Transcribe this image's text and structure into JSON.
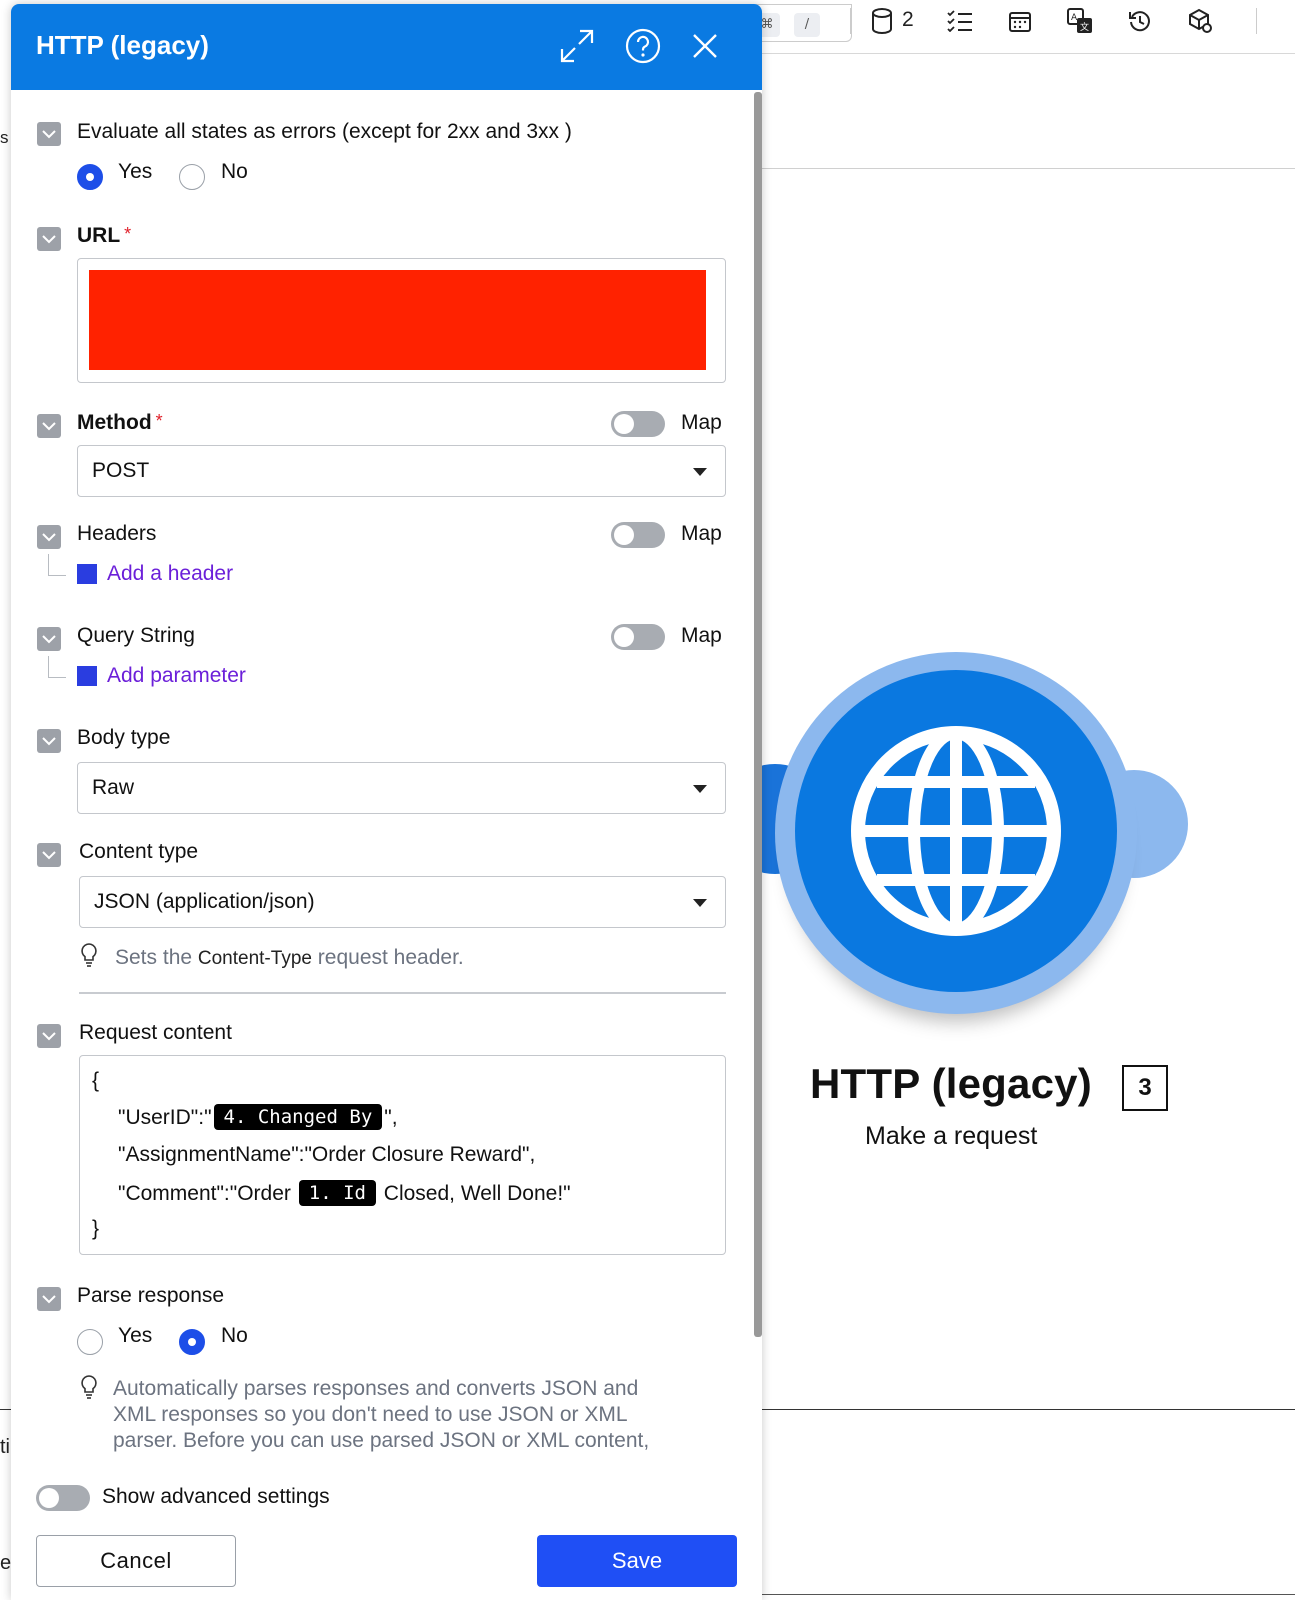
{
  "toolbar": {
    "kbd_cmd": "⌘",
    "kbd_slash": "/",
    "datastore_count": "2",
    "icons": [
      "database-icon",
      "checklist-icon",
      "calendar-icon",
      "translate-icon",
      "history-icon",
      "package-settings-icon"
    ]
  },
  "background": {
    "edge_s": "s",
    "edge_ti": "ti",
    "edge_e": "e"
  },
  "module": {
    "title": "HTTP (legacy)",
    "badge": "3",
    "subtitle": "Make a request",
    "icon": "globe-icon"
  },
  "panel": {
    "title": "HTTP (legacy)",
    "evaluate": {
      "label": "Evaluate all states as errors (except for 2xx and 3xx )",
      "yes": "Yes",
      "no": "No",
      "selected": "Yes"
    },
    "url": {
      "label": "URL",
      "required": "*"
    },
    "method": {
      "label": "Method",
      "required": "*",
      "map": "Map",
      "value": "POST"
    },
    "headers": {
      "label": "Headers",
      "map": "Map",
      "add": "Add a header"
    },
    "query": {
      "label": "Query String",
      "map": "Map",
      "add": "Add parameter"
    },
    "body_type": {
      "label": "Body type",
      "value": "Raw"
    },
    "content_type": {
      "label": "Content type",
      "value": "JSON (application/json)",
      "hint_pre": "Sets the ",
      "hint_code": "Content-Type",
      "hint_post": " request header."
    },
    "request_content": {
      "label": "Request content",
      "open_brace": "{",
      "line1_pre": "\"UserID\":\"",
      "line1_pill": "4. Changed By",
      "line1_post": "\",",
      "line2": "\"AssignmentName\":\"Order Closure Reward\",",
      "line3_pre": "\"Comment\":\"Order ",
      "line3_pill": "1. Id",
      "line3_post": " Closed, Well Done!\"",
      "close_brace": "}"
    },
    "parse_response": {
      "label": "Parse response",
      "yes": "Yes",
      "no": "No",
      "selected": "No",
      "hint_line1": "Automatically parses responses and converts JSON and",
      "hint_line2": "XML responses so you don't need to use JSON or XML",
      "hint_line3": "parser. Before you can use parsed JSON or XML content,"
    },
    "advanced": "Show advanced settings",
    "cancel": "Cancel",
    "save": "Save"
  },
  "colors": {
    "header": "#0a7ae2",
    "save": "#1f4ff5",
    "link": "#6b1fd9",
    "redaction": "#ff2200",
    "module_inner": "#0a78e0",
    "module_outer": "#8cb8ee"
  }
}
